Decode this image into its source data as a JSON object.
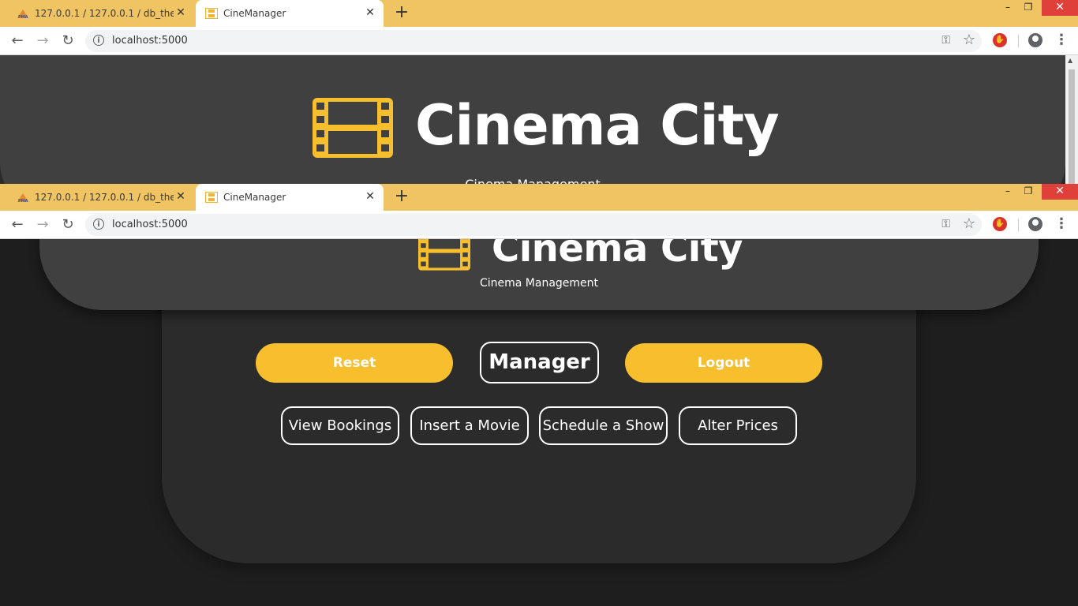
{
  "browser": {
    "tabs": [
      {
        "title": "127.0.0.1 / 127.0.0.1 / db_theatre",
        "favicon": "phpmyadmin-icon"
      },
      {
        "title": "CineManager",
        "favicon": "film-icon"
      }
    ],
    "new_tab": "+",
    "url": "localhost:5000",
    "window_controls": {
      "minimize": "–",
      "maximize": "❐",
      "close": "✕"
    }
  },
  "site": {
    "title": "Cinema City",
    "subtitle": "Cinema Management",
    "logo": "film-icon"
  },
  "top_buttons": {
    "reset": "Reset",
    "role": "Manager",
    "logout": "Logout"
  },
  "actions": [
    "View Bookings",
    "Insert a Movie",
    "Schedule a Show",
    "Alter Prices"
  ],
  "colors": {
    "accent": "#f7be2e",
    "tabbar": "#f0c462",
    "header": "#404040",
    "panel": "#2b2b2b",
    "background": "#1e1e1e"
  }
}
